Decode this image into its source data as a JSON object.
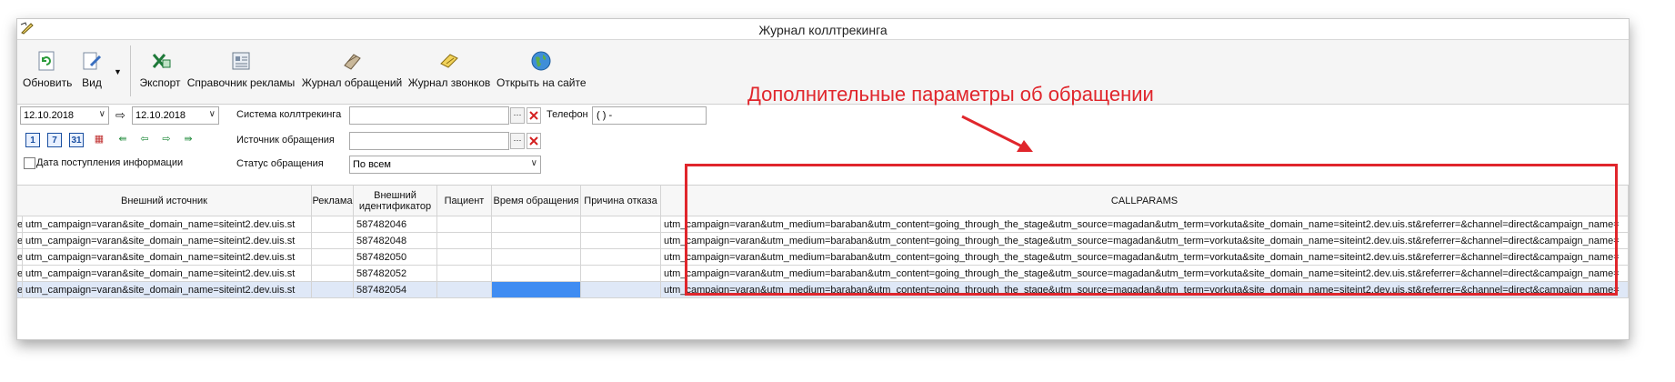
{
  "window": {
    "title": "Журнал коллтрекинга"
  },
  "toolbar": {
    "refresh": "Обновить",
    "view": "Вид",
    "export": "Экспорт",
    "ads_dir": "Справочник рекламы",
    "requests_log": "Журнал обращений",
    "calls_log": "Журнал звонков",
    "open_site": "Открыть на сайте"
  },
  "filters": {
    "date_from": "12.10.2018",
    "date_to": "12.10.2018",
    "tracking_system_label": "Система коллтрекинга",
    "phone_label": "Телефон",
    "phone_value": "( ) -",
    "source_label": "Источник обращения",
    "status_label": "Статус обращения",
    "status_value": "По всем",
    "date_received_label": "Дата поступления информации",
    "cal_day": "1",
    "cal_week": "7",
    "cal_month": "31"
  },
  "annotation": {
    "text": "Дополнительные параметры об обращении"
  },
  "table": {
    "columns": {
      "external_source": "Внешний источник",
      "ad": "Реклама",
      "external_id": "Внешний идентификатор",
      "patient": "Пациент",
      "time": "Время обращения",
      "reject_reason": "Причина отказа",
      "callparams": "CALLPARAMS"
    },
    "rows": [
      {
        "lead": "e",
        "source": "utm_campaign=varan&site_domain_name=siteint2.dev.uis.st",
        "ad": "",
        "ext_id": "587482046",
        "patient": "",
        "time": "",
        "reason": "",
        "callparams": "utm_campaign=varan&utm_medium=baraban&utm_content=going_through_the_stage&utm_source=magadan&utm_term=vorkuta&site_domain_name=siteint2.dev.uis.st&referrer=&channel=direct&campaign_name="
      },
      {
        "lead": "e",
        "source": "utm_campaign=varan&site_domain_name=siteint2.dev.uis.st",
        "ad": "",
        "ext_id": "587482048",
        "patient": "",
        "time": "",
        "reason": "",
        "callparams": "utm_campaign=varan&utm_medium=baraban&utm_content=going_through_the_stage&utm_source=magadan&utm_term=vorkuta&site_domain_name=siteint2.dev.uis.st&referrer=&channel=direct&campaign_name="
      },
      {
        "lead": "e",
        "source": "utm_campaign=varan&site_domain_name=siteint2.dev.uis.st",
        "ad": "",
        "ext_id": "587482050",
        "patient": "",
        "time": "",
        "reason": "",
        "callparams": "utm_campaign=varan&utm_medium=baraban&utm_content=going_through_the_stage&utm_source=magadan&utm_term=vorkuta&site_domain_name=siteint2.dev.uis.st&referrer=&channel=direct&campaign_name="
      },
      {
        "lead": "e",
        "source": "utm_campaign=varan&site_domain_name=siteint2.dev.uis.st",
        "ad": "",
        "ext_id": "587482052",
        "patient": "",
        "time": "",
        "reason": "",
        "callparams": "utm_campaign=varan&utm_medium=baraban&utm_content=going_through_the_stage&utm_source=magadan&utm_term=vorkuta&site_domain_name=siteint2.dev.uis.st&referrer=&channel=direct&campaign_name="
      },
      {
        "lead": "e",
        "source": "utm_campaign=varan&site_domain_name=siteint2.dev.uis.st",
        "ad": "",
        "ext_id": "587482054",
        "patient": "",
        "time": "",
        "reason": "",
        "callparams": "utm_campaign=varan&utm_medium=baraban&utm_content=going_through_the_stage&utm_source=magadan&utm_term=vorkuta&site_domain_name=siteint2.dev.uis.st&referrer=&channel=direct&campaign_name="
      }
    ]
  },
  "colors": {
    "annotation_red": "#e0262c",
    "selected_row": "#dfe8f7",
    "selected_cell": "#3f8cf2"
  }
}
